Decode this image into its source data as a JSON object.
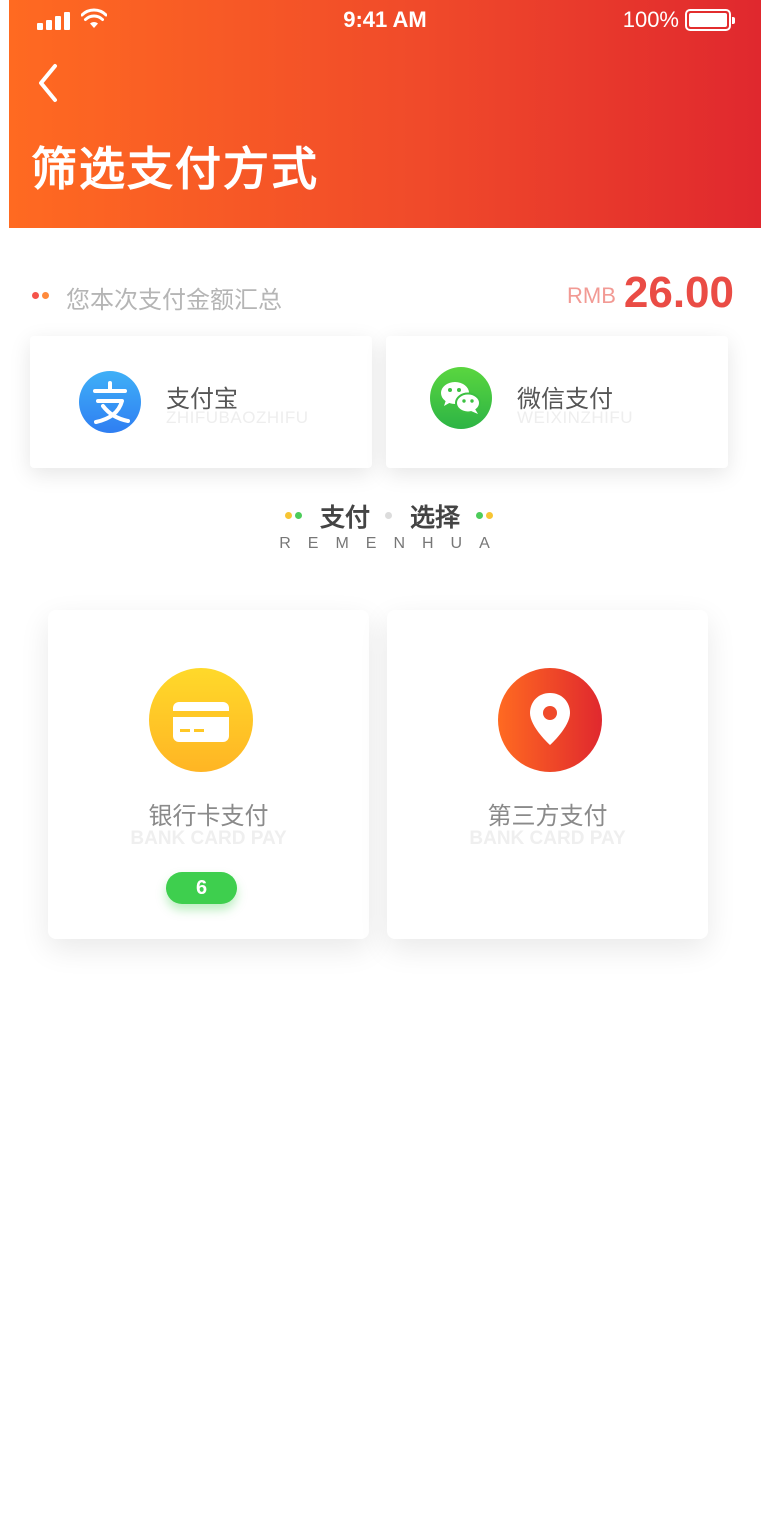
{
  "status_bar": {
    "time": "9:41 AM",
    "battery": "100%"
  },
  "header": {
    "title": "筛选支付方式"
  },
  "summary": {
    "label": "您本次支付金额汇总",
    "currency": "RMB",
    "amount": "26.00"
  },
  "methods": [
    {
      "name": "支付宝",
      "sub": "ZHIFUBAOZHIFU",
      "icon": "alipay-icon",
      "color": "#3b8ff0"
    },
    {
      "name": "微信支付",
      "sub": "WEIXINZHIFU",
      "icon": "wechat-icon",
      "color": "#3cc142"
    }
  ],
  "section": {
    "title_left": "支付",
    "title_right": "选择",
    "subtitle": "REMENHUA"
  },
  "options": [
    {
      "name": "银行卡支付",
      "sub": "BANK CARD PAY",
      "badge": "6",
      "icon": "bank-card-icon",
      "color": "#ffc21f"
    },
    {
      "name": "第三方支付",
      "sub": "BANK CARD PAY",
      "icon": "location-pin-icon",
      "color": "#f04a2a"
    }
  ]
}
